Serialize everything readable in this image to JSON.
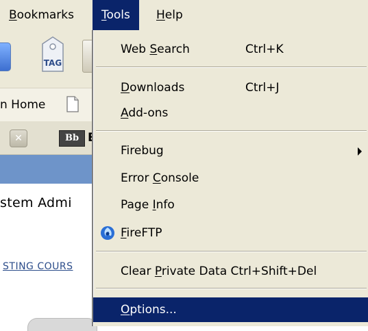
{
  "menubar": {
    "items": [
      {
        "label": "Bookmarks",
        "mnemonic": "B",
        "rest": "ookmarks"
      },
      {
        "label": "Tools",
        "mnemonic": "T",
        "rest": "ools"
      },
      {
        "label": "Help",
        "mnemonic": "H",
        "rest": "elp"
      }
    ],
    "active": "Tools"
  },
  "background": {
    "tag_label": "TAG",
    "bookmark_text": "n Home",
    "tab_logo": "Bb",
    "tab_letter": "E",
    "content_text": "stem Admi",
    "content_link": "STING COURS"
  },
  "tools_menu": {
    "web_search": {
      "pre": "Web ",
      "mnemonic": "S",
      "post": "earch",
      "shortcut": "Ctrl+K"
    },
    "downloads": {
      "pre": "",
      "mnemonic": "D",
      "post": "ownloads",
      "shortcut": "Ctrl+J"
    },
    "addons": {
      "pre": "",
      "mnemonic": "A",
      "post": "dd-ons"
    },
    "firebug": {
      "label": "Firebug"
    },
    "error_console": {
      "pre": "Error ",
      "mnemonic": "C",
      "post": "onsole"
    },
    "page_info": {
      "pre": "Page ",
      "mnemonic": "I",
      "post": "nfo"
    },
    "fireftp": {
      "pre": "",
      "mnemonic": "F",
      "post": "ireFTP"
    },
    "clear_private_data": {
      "pre": "Clear ",
      "mnemonic": "P",
      "post": "rivate Data Ctrl+Shift+Del"
    },
    "options": {
      "pre": "",
      "mnemonic": "O",
      "post": "ptions..."
    }
  },
  "colors": {
    "menu_bg": "#ece9d8",
    "highlight": "#0a246a",
    "tab_bar_blue": "#6e94c9"
  }
}
